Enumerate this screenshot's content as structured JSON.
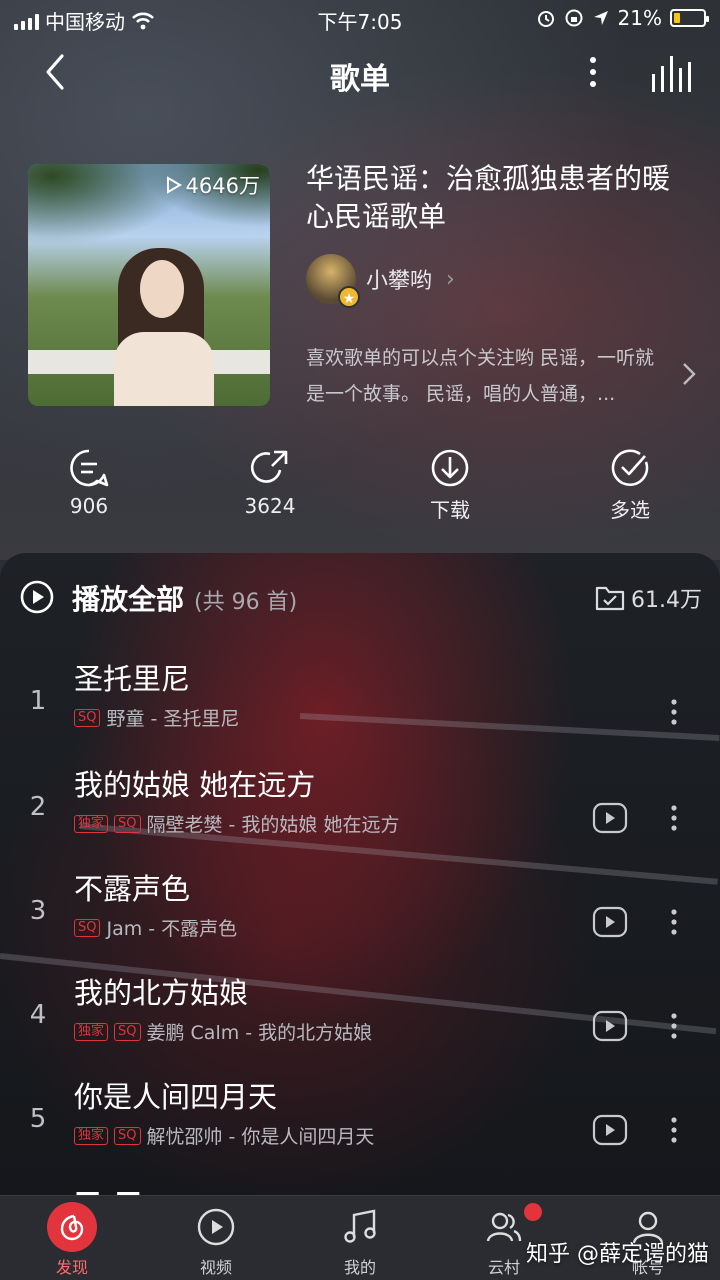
{
  "status_bar": {
    "carrier": "中国移动",
    "time": "下午7:05",
    "battery": "21%",
    "battery_level": 0.21
  },
  "navbar": {
    "title": "歌单"
  },
  "playlist": {
    "play_count": "4646万",
    "title": "华语民谣：治愈孤独患者的暖心民谣歌单",
    "creator": "小攀哟",
    "description": "喜欢歌单的可以点个关注哟 民谣，一听就是一个故事。 民谣，唱的人普通，..."
  },
  "actions": {
    "comment_count": "906",
    "share_count": "3624",
    "download_label": "下载",
    "multiselect_label": "多选"
  },
  "play_all": {
    "label": "播放全部",
    "count": "(共 96 首)",
    "fav_count": "61.4万"
  },
  "songs": [
    {
      "index": "1",
      "name": "圣托里尼",
      "tags": [
        "SQ"
      ],
      "artist_album": "野童 - 圣托里尼",
      "has_mv": false
    },
    {
      "index": "2",
      "name": "我的姑娘 她在远方",
      "tags": [
        "独家",
        "SQ"
      ],
      "artist_album": "隔壁老樊 - 我的姑娘 她在远方",
      "has_mv": true
    },
    {
      "index": "3",
      "name": "不露声色",
      "tags": [
        "SQ"
      ],
      "artist_album": "Jam - 不露声色",
      "has_mv": true
    },
    {
      "index": "4",
      "name": "我的北方姑娘",
      "tags": [
        "独家",
        "SQ"
      ],
      "artist_album": "姜鹏 Calm - 我的北方姑娘",
      "has_mv": true
    },
    {
      "index": "5",
      "name": "你是人间四月天",
      "tags": [
        "独家",
        "SQ"
      ],
      "artist_album": "解忧邵帅 - 你是人间四月天",
      "has_mv": true
    }
  ],
  "tabbar": {
    "discover": "发现",
    "video": "视频",
    "mine": "我的",
    "cloud_village": "云村",
    "account": "帐号"
  },
  "watermark": "知乎 @薛定谔的猫",
  "colors": {
    "accent_red": "#e2343d",
    "background": "#2b2f35"
  }
}
